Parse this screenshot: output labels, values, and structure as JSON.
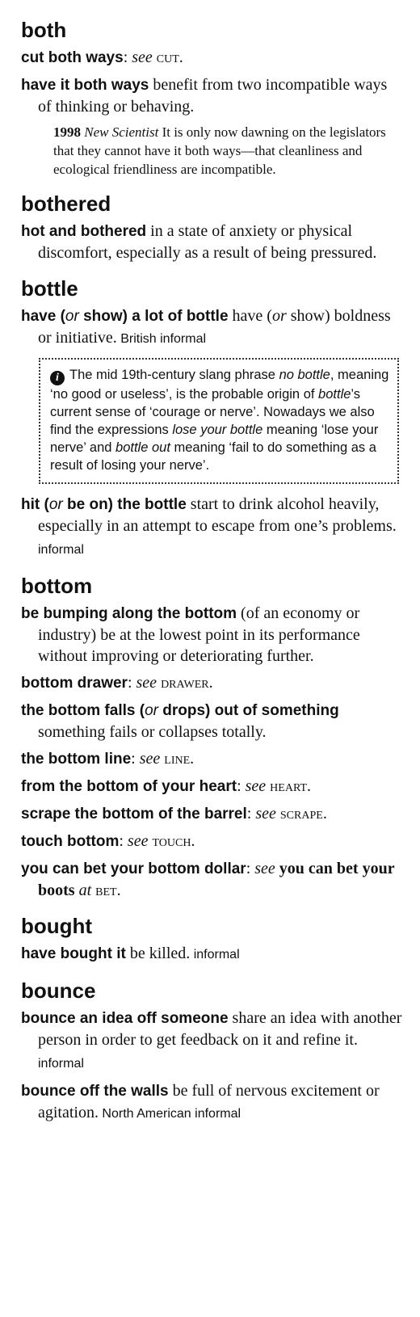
{
  "sections": [
    {
      "headword": "both",
      "entries": [
        {
          "phrase": "cut both ways",
          "sep": ": ",
          "see": "see",
          "target": "cut"
        },
        {
          "phrase": "have it both ways",
          "definition": " benefit from two incompatible ways of thinking or behaving.",
          "quote": {
            "year": "1998",
            "source": "New Scientist",
            "text": " It is only now dawning on the legislators that they cannot have it both ways—that cleanliness and ecological friendliness are incompatible."
          }
        }
      ]
    },
    {
      "headword": "bothered",
      "entries": [
        {
          "phrase": "hot and bothered",
          "definition": " in a state of anxiety or physical discomfort, especially as a result of being pressured."
        }
      ]
    },
    {
      "headword": "bottle",
      "entries": [
        {
          "phrase_a": "have (",
          "or": "or",
          "phrase_b": " show) a lot of bottle",
          "def_a": " have (",
          "def_or": "or",
          "def_b": " show) boldness or initiative.",
          "register": " British informal"
        },
        {
          "phrase_a": "hit (",
          "or": "or",
          "phrase_b": " be on) the bottle",
          "definition": " start to drink alcohol heavily, especially in an attempt to escape from one’s problems.",
          "register": " informal"
        }
      ],
      "note": {
        "t1": "The mid 19th-century slang phrase ",
        "i1": "no bottle",
        "t2": ", meaning ‘no good or useless’, is the probable origin of ",
        "i2": "bottle",
        "t3": "’s current sense of ‘courage or nerve’. Nowadays we also find the expressions ",
        "i3": "lose your bottle",
        "t4": " meaning ‘lose your nerve’ and ",
        "i4": "bottle out",
        "t5": " meaning ‘fail to do something as a result of losing your nerve’."
      }
    },
    {
      "headword": "bottom",
      "entries": [
        {
          "phrase": "be bumping along the bottom",
          "definition": " (of an economy or industry) be at the lowest point in its performance without improving or deteriorating further."
        },
        {
          "phrase": "bottom drawer",
          "sep": ": ",
          "see": "see",
          "target": "drawer"
        },
        {
          "phrase_a": "the bottom falls (",
          "or": "or",
          "phrase_b": " drops) out of something",
          "definition": " something fails or collapses totally."
        },
        {
          "phrase": "the bottom line",
          "sep": ": ",
          "see": "see",
          "target": "line"
        },
        {
          "phrase": "from the bottom of your heart",
          "sep": ": ",
          "see": "see",
          "target": "heart"
        },
        {
          "phrase": "scrape the bottom of the barrel",
          "sep": ": ",
          "see": "see",
          "target": "scrape"
        },
        {
          "phrase": "touch bottom",
          "sep": ": ",
          "see": "see",
          "target": "touch"
        },
        {
          "phrase": "you can bet your bottom dollar",
          "sep": ": ",
          "see": "see",
          "xref": " you can bet your boots",
          "at": " at",
          "target": "bet"
        }
      ]
    },
    {
      "headword": "bought",
      "entries": [
        {
          "phrase": "have bought it",
          "definition": " be killed.",
          "register": " informal"
        }
      ]
    },
    {
      "headword": "bounce",
      "entries": [
        {
          "phrase": "bounce an idea off someone",
          "definition": " share an idea with another person in order to get feedback on it and refine it.",
          "register": " informal"
        },
        {
          "phrase": "bounce off the walls",
          "definition": " be full of nervous excitement or agitation.",
          "register": " North American informal"
        }
      ]
    }
  ]
}
